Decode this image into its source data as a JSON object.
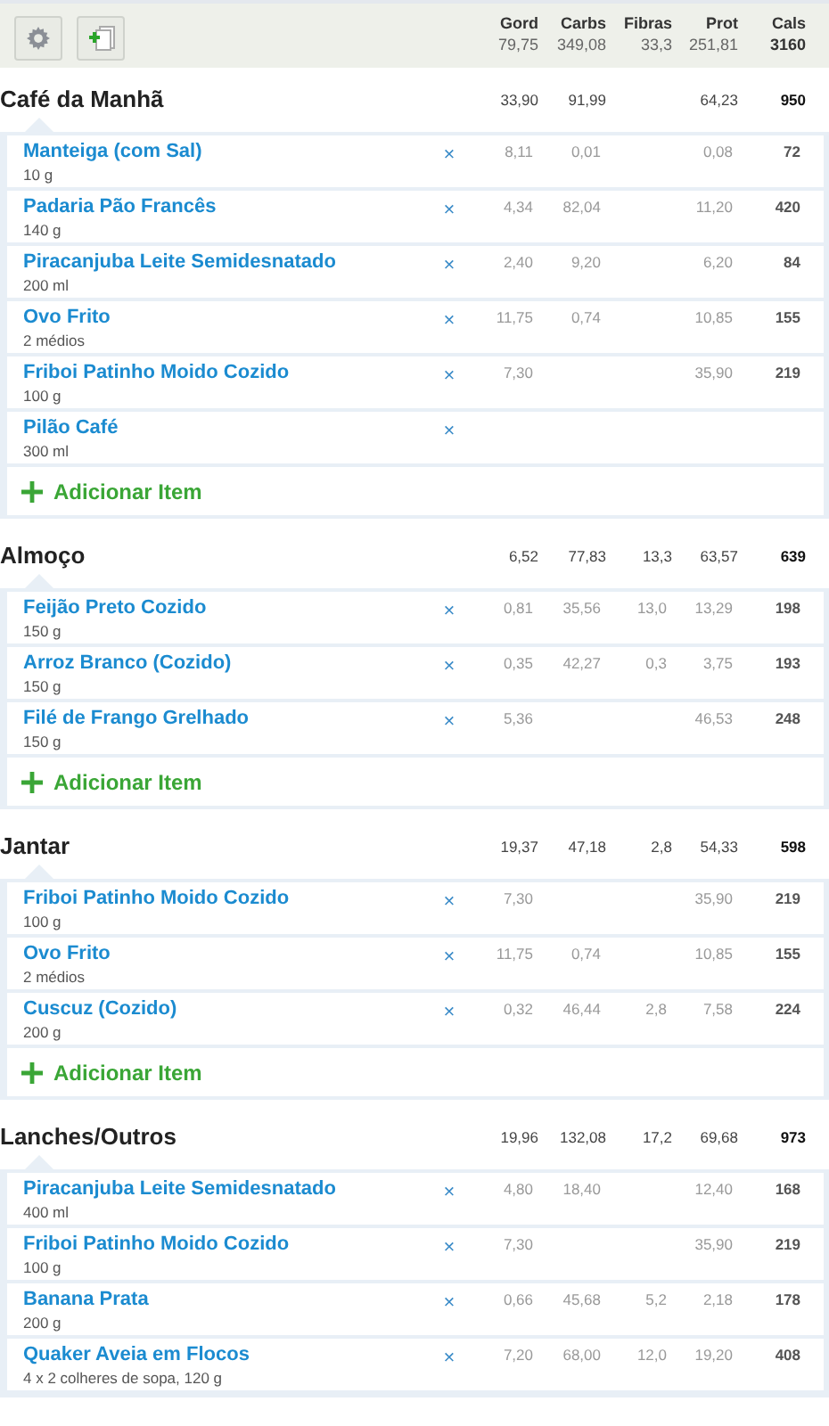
{
  "toolbar": {
    "columns": [
      "Gord",
      "Carbs",
      "Fibras",
      "Prot",
      "Cals"
    ],
    "totals": {
      "gord": "79,75",
      "carbs": "349,08",
      "fibras": "33,3",
      "prot": "251,81",
      "cals": "3160"
    }
  },
  "meals": [
    {
      "name": "Café da Manhã",
      "totals": {
        "gord": "33,90",
        "carbs": "91,99",
        "prot": "64,23",
        "cals": "950"
      },
      "items": [
        {
          "name": "Manteiga (com Sal)",
          "serving": "10 g",
          "delete": "×",
          "values": {
            "gord": "8,11",
            "carbs": "0,01",
            "prot": "0,08",
            "cals": "72"
          }
        },
        {
          "name": "Padaria Pão Francês",
          "serving": "140 g",
          "delete": "×",
          "values": {
            "gord": "4,34",
            "carbs": "82,04",
            "prot": "11,20",
            "cals": "420"
          }
        },
        {
          "name": "Piracanjuba Leite Semidesnatado",
          "serving": "200 ml",
          "delete": "×",
          "values": {
            "gord": "2,40",
            "carbs": "9,20",
            "prot": "6,20",
            "cals": "84"
          }
        },
        {
          "name": "Ovo Frito",
          "serving": "2 médios",
          "delete": "×",
          "values": {
            "gord": "11,75",
            "carbs": "0,74",
            "prot": "10,85",
            "cals": "155"
          }
        },
        {
          "name": "Friboi Patinho Moido Cozido",
          "serving": "100 g",
          "delete": "×",
          "values": {
            "gord": "7,30",
            "prot": "35,90",
            "cals": "219"
          }
        },
        {
          "name": "Pilão Café",
          "serving": "300 ml",
          "delete": "×"
        }
      ],
      "add_item": "Adicionar Item"
    },
    {
      "name": "Almoço",
      "totals": {
        "gord": "6,52",
        "carbs": "77,83",
        "fibras": "13,3",
        "prot": "63,57",
        "cals": "639"
      },
      "items": [
        {
          "name": "Feijão Preto Cozido",
          "serving": "150 g",
          "delete": "×",
          "values": {
            "gord": "0,81",
            "carbs": "35,56",
            "fibras": "13,0",
            "prot": "13,29",
            "cals": "198"
          }
        },
        {
          "name": "Arroz Branco (Cozido)",
          "serving": "150 g",
          "delete": "×",
          "values": {
            "gord": "0,35",
            "carbs": "42,27",
            "fibras": "0,3",
            "prot": "3,75",
            "cals": "193"
          }
        },
        {
          "name": "Filé de Frango Grelhado",
          "serving": "150 g",
          "delete": "×",
          "values": {
            "gord": "5,36",
            "prot": "46,53",
            "cals": "248"
          }
        }
      ],
      "add_item": "Adicionar Item"
    },
    {
      "name": "Jantar",
      "totals": {
        "gord": "19,37",
        "carbs": "47,18",
        "fibras": "2,8",
        "prot": "54,33",
        "cals": "598"
      },
      "items": [
        {
          "name": "Friboi Patinho Moido Cozido",
          "serving": "100 g",
          "delete": "×",
          "values": {
            "gord": "7,30",
            "prot": "35,90",
            "cals": "219"
          }
        },
        {
          "name": "Ovo Frito",
          "serving": "2 médios",
          "delete": "×",
          "values": {
            "gord": "11,75",
            "carbs": "0,74",
            "prot": "10,85",
            "cals": "155"
          }
        },
        {
          "name": "Cuscuz (Cozido)",
          "serving": "200 g",
          "delete": "×",
          "values": {
            "gord": "0,32",
            "carbs": "46,44",
            "fibras": "2,8",
            "prot": "7,58",
            "cals": "224"
          }
        }
      ],
      "add_item": "Adicionar Item"
    },
    {
      "name": "Lanches/Outros",
      "totals": {
        "gord": "19,96",
        "carbs": "132,08",
        "fibras": "17,2",
        "prot": "69,68",
        "cals": "973"
      },
      "items": [
        {
          "name": "Piracanjuba Leite Semidesnatado",
          "serving": "400 ml",
          "delete": "×",
          "values": {
            "gord": "4,80",
            "carbs": "18,40",
            "prot": "12,40",
            "cals": "168"
          }
        },
        {
          "name": "Friboi Patinho Moido Cozido",
          "serving": "100 g",
          "delete": "×",
          "values": {
            "gord": "7,30",
            "prot": "35,90",
            "cals": "219"
          }
        },
        {
          "name": "Banana Prata",
          "serving": "200 g",
          "delete": "×",
          "values": {
            "gord": "0,66",
            "carbs": "45,68",
            "fibras": "5,2",
            "prot": "2,18",
            "cals": "178"
          }
        },
        {
          "name": "Quaker Aveia em Flocos",
          "serving": "4 x 2 colheres de sopa, 120 g",
          "delete": "×",
          "values": {
            "gord": "7,20",
            "carbs": "68,00",
            "fibras": "12,0",
            "prot": "19,20",
            "cals": "408"
          }
        }
      ]
    }
  ]
}
